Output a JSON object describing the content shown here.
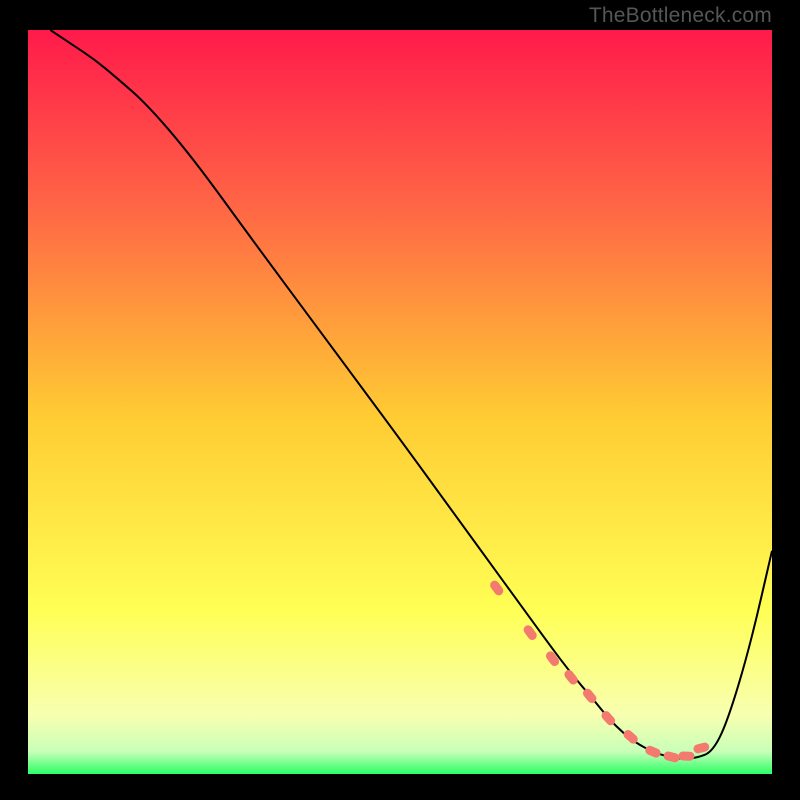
{
  "watermark": "TheBottleneck.com",
  "chart_data": {
    "type": "line",
    "title": "",
    "xlabel": "",
    "ylabel": "",
    "xlim": [
      0,
      100
    ],
    "ylim": [
      0,
      100
    ],
    "grid": false,
    "background_gradient": {
      "stops": [
        {
          "offset": 0.0,
          "color": "#ff1a4b"
        },
        {
          "offset": 0.25,
          "color": "#ff6a45"
        },
        {
          "offset": 0.52,
          "color": "#ffcc33"
        },
        {
          "offset": 0.78,
          "color": "#ffff55"
        },
        {
          "offset": 0.92,
          "color": "#f8ffb0"
        },
        {
          "offset": 0.97,
          "color": "#c8ffb8"
        },
        {
          "offset": 1.0,
          "color": "#2aff66"
        }
      ]
    },
    "series": [
      {
        "name": "curve",
        "stroke": "#000000",
        "stroke_width": 2,
        "x": [
          3,
          6,
          9,
          12,
          16,
          22,
          30,
          40,
          50,
          58,
          62,
          66,
          70,
          73,
          76,
          78,
          80,
          82,
          84,
          86,
          88,
          90,
          92,
          94,
          97,
          100
        ],
        "y": [
          100,
          98,
          96,
          93.5,
          90,
          83,
          72,
          58.5,
          45,
          34,
          28.5,
          23,
          17.5,
          13.5,
          10,
          7.5,
          5.5,
          4,
          3,
          2.3,
          2,
          2.2,
          3,
          7,
          17,
          30
        ]
      },
      {
        "name": "markers",
        "type": "scatter",
        "color": "#f47a6f",
        "marker_shape": "rounded-dash",
        "x": [
          63,
          67.5,
          70.5,
          73,
          75.5,
          78,
          81,
          84,
          86.5,
          88.5,
          90.5
        ],
        "y": [
          25,
          19,
          15.5,
          13,
          10.5,
          7.5,
          5,
          3,
          2.3,
          2.4,
          3.5
        ]
      }
    ]
  }
}
